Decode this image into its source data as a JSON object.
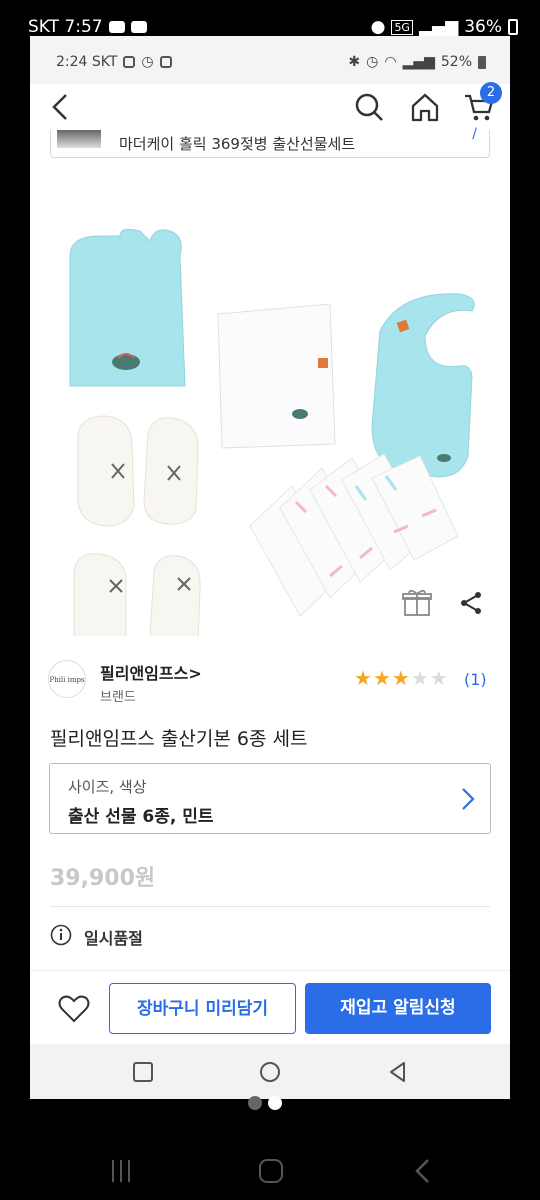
{
  "outer_status": {
    "carrier_time": "SKT 7:57",
    "network": "5G",
    "battery": "36%"
  },
  "inner_status": {
    "time_carrier": "2:24 SKT",
    "battery": "52%"
  },
  "header": {
    "cart_count": "2"
  },
  "set_banner": {
    "text": "마더케이 홀릭 369젖병 출산선물세트",
    "edit_mark": "/"
  },
  "brand": {
    "logo_text": "Phili imps",
    "name": "필리앤임프스>",
    "sub": "브랜드"
  },
  "rating": {
    "stars_filled": 3,
    "stars_total": 5,
    "count": "(1)",
    "star_color": "#f5a623"
  },
  "product": {
    "title": "필리앤임프스 출산기본 6종 세트",
    "option_label": "사이즈, 색상",
    "option_value": "출산 선물 6종, 민트",
    "price": "39,900원",
    "status": "일시품절"
  },
  "actions": {
    "cart_button": "장바구니 미리담기",
    "notify_button": "재입고 알림신청"
  },
  "colors": {
    "accent": "#2b6de6",
    "mint": "#a8e4ec"
  }
}
